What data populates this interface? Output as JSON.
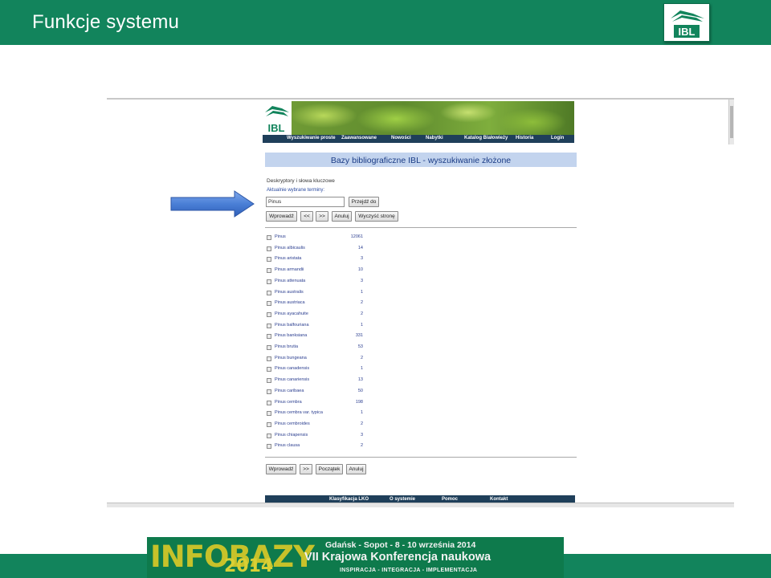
{
  "slide": {
    "title": "Funkcje systemu"
  },
  "screenshot": {
    "nav": [
      "Wyszukiwanie proste",
      "Zaawansowane",
      "Nowości",
      "Nabytki",
      "Katalog Białowieży",
      "Historia",
      "Login"
    ],
    "page_title": "Bazy bibliograficzne IBL - wyszukiwanie złożone",
    "section_label": "Deskryptory i słowa kluczowe",
    "section_sub": "Aktualnie wybrane terminy:",
    "search_value": "Pinus",
    "go_button": "Przejdź do",
    "top_buttons": {
      "enter": "Wprowadź",
      "prev": "<<",
      "next": ">>",
      "cancel": "Anuluj",
      "clear": "Wyczyść stronę"
    },
    "rows": [
      {
        "name": "Pinus",
        "count": "12061"
      },
      {
        "name": "Pinus albicaulis",
        "count": "14"
      },
      {
        "name": "Pinus aristata",
        "count": "3"
      },
      {
        "name": "Pinus armandii",
        "count": "10"
      },
      {
        "name": "Pinus attenuata",
        "count": "3"
      },
      {
        "name": "Pinus australis",
        "count": "1"
      },
      {
        "name": "Pinus austriaca",
        "count": "2"
      },
      {
        "name": "Pinus ayacahuite",
        "count": "2"
      },
      {
        "name": "Pinus balfouriana",
        "count": "1"
      },
      {
        "name": "Pinus banksiana",
        "count": "331"
      },
      {
        "name": "Pinus brutia",
        "count": "53"
      },
      {
        "name": "Pinus bungeana",
        "count": "2"
      },
      {
        "name": "Pinus canadensis",
        "count": "1"
      },
      {
        "name": "Pinus canariensis",
        "count": "13"
      },
      {
        "name": "Pinus caribaea",
        "count": "50"
      },
      {
        "name": "Pinus cembra",
        "count": "198"
      },
      {
        "name": "Pinus cembra var. typica",
        "count": "1"
      },
      {
        "name": "Pinus cembroides",
        "count": "2"
      },
      {
        "name": "Pinus chiapensis",
        "count": "3"
      },
      {
        "name": "Pinus clausa",
        "count": "2"
      }
    ],
    "bottom_buttons": {
      "enter": "Wprowadź",
      "next": ">>",
      "start": "Początek",
      "cancel": "Anuluj"
    },
    "footer_nav": [
      "Klasyfikacja LKO",
      "O systemie",
      "Pomoc",
      "Kontakt"
    ]
  },
  "conference": {
    "logo": "INFOBAZY",
    "year": "2014",
    "line1": "Gdańsk - Sopot  -  8 - 10 września 2014",
    "line2": "VII Krajowa Konferencja naukowa",
    "line3": "INSPIRACJA  -  INTEGRACJA  -  IMPLEMENTACJA"
  },
  "colors": {
    "brand_green": "#12845c",
    "nav_dark": "#1f3f5a",
    "title_bar": "#c3d4ee",
    "arrow_blue": "#4a7fd6"
  }
}
